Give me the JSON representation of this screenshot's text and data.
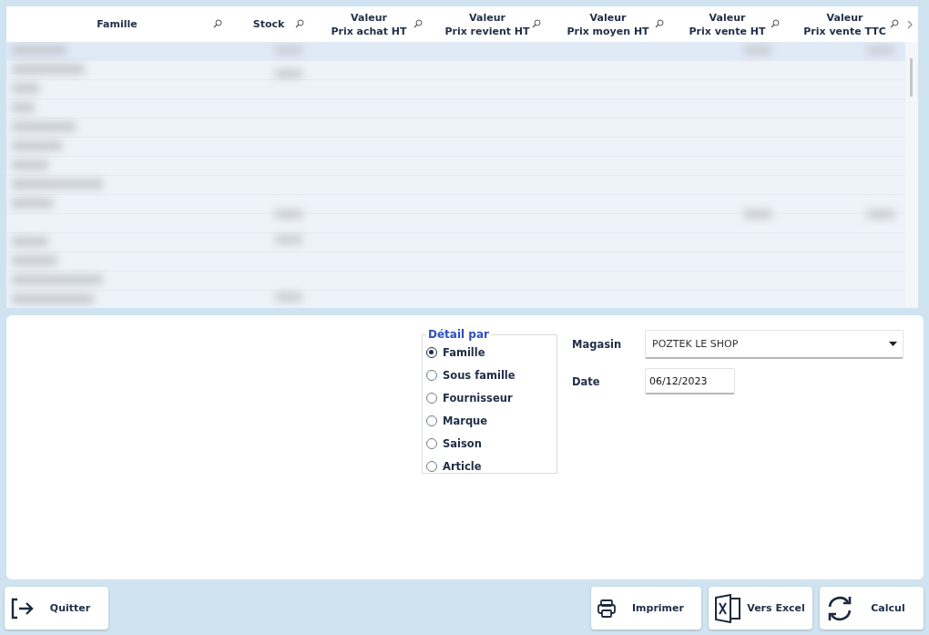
{
  "table": {
    "columns": [
      {
        "label": "Famille"
      },
      {
        "label": "Stock"
      },
      {
        "label": "Valeur\nPrix achat HT"
      },
      {
        "label": "Valeur\nPrix revient HT"
      },
      {
        "label": "Valeur\nPrix moyen HT"
      },
      {
        "label": "Valeur\nPrix vente HT"
      },
      {
        "label": "Valeur\nPrix vente TTC"
      }
    ]
  },
  "detail": {
    "title": "Détail par",
    "options": [
      {
        "label": "Famille",
        "selected": true
      },
      {
        "label": "Sous famille",
        "selected": false
      },
      {
        "label": "Fournisseur",
        "selected": false
      },
      {
        "label": "Marque",
        "selected": false
      },
      {
        "label": "Saison",
        "selected": false
      },
      {
        "label": "Article",
        "selected": false
      }
    ]
  },
  "magasin": {
    "label": "Magasin",
    "value": "POZTEK LE SHOP"
  },
  "date": {
    "label": "Date",
    "value": "06/12/2023"
  },
  "buttons": [
    {
      "kind": "quit",
      "label": "Quitter"
    },
    {
      "kind": "print",
      "label": "Imprimer"
    },
    {
      "kind": "excel",
      "label": "Vers Excel"
    },
    {
      "kind": "refresh",
      "label": "Calcul"
    }
  ]
}
